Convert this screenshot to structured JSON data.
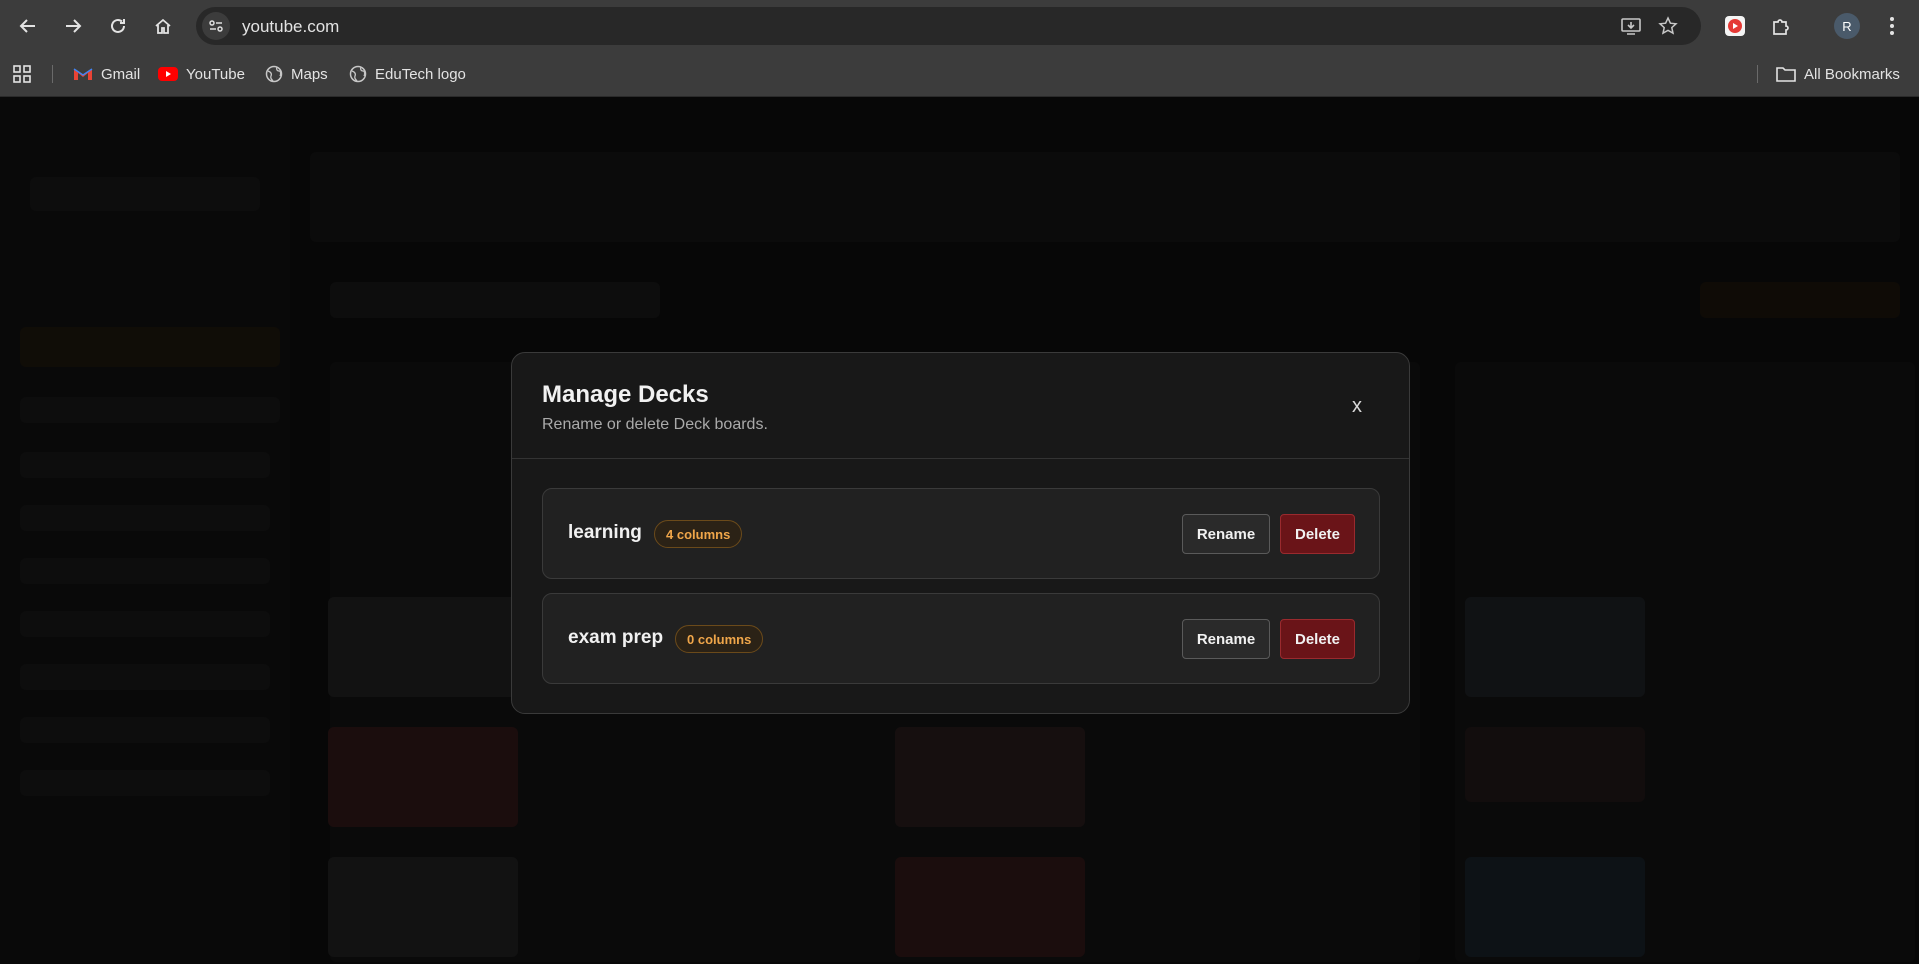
{
  "browser": {
    "url": "youtube.com",
    "profile_initial": "R",
    "bookmarks": [
      {
        "label": "Gmail",
        "icon": "gmail-icon"
      },
      {
        "label": "YouTube",
        "icon": "youtube-icon"
      },
      {
        "label": "Maps",
        "icon": "globe-icon"
      },
      {
        "label": "EduTech logo",
        "icon": "globe-icon"
      }
    ],
    "all_bookmarks_label": "All Bookmarks"
  },
  "modal": {
    "title": "Manage Decks",
    "subtitle": "Rename or delete Deck boards.",
    "close_label": "x",
    "decks": [
      {
        "name": "learning",
        "badge": "4 columns",
        "rename_label": "Rename",
        "delete_label": "Delete"
      },
      {
        "name": "exam prep",
        "badge": "0 columns",
        "rename_label": "Rename",
        "delete_label": "Delete"
      }
    ]
  },
  "colors": {
    "accent": "#f0a64a",
    "delete": "#6a1418",
    "modal_bg": "#181818"
  }
}
